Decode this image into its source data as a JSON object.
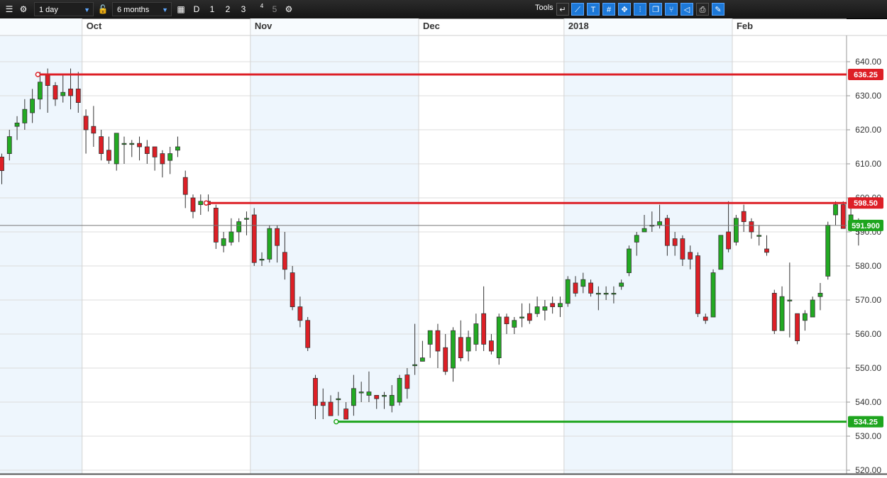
{
  "toolbar": {
    "interval": "1 day",
    "range": "6 months",
    "period_d": "D",
    "period_1": "1",
    "period_2": "2",
    "period_3": "3",
    "period_4": "4",
    "period_5": "5",
    "tools_label": "Tools"
  },
  "icons": [
    "list-icon",
    "gear-icon",
    "lock-icon",
    "calendar-icon",
    "settings-icon",
    "undo-icon",
    "trendline-icon",
    "text-icon",
    "grid-icon",
    "crosshair-icon",
    "candle-icon",
    "duplicate-icon",
    "fork-icon",
    "shape-icon",
    "print-icon",
    "config-icon"
  ],
  "colors": {
    "up": "#22aa22",
    "down": "#dd1f26",
    "accent": "#1c78d8",
    "band": "#eef6fd",
    "price": "#1ea51e"
  },
  "chart_data": {
    "type": "candlestick",
    "x_labels": [
      {
        "label": "Oct",
        "index": 11
      },
      {
        "label": "Nov",
        "index": 33
      },
      {
        "label": "Dec",
        "index": 55
      },
      {
        "label": "2018",
        "index": 74
      },
      {
        "label": "Feb",
        "index": 96
      }
    ],
    "bands": [
      [
        -10,
        11
      ],
      [
        33,
        55
      ],
      [
        74,
        96
      ]
    ],
    "ylim": [
      517,
      647
    ],
    "yticks": [
      520,
      530,
      540,
      550,
      560,
      570,
      580,
      590,
      600,
      610,
      620,
      630,
      640
    ],
    "candles": [
      [
        612,
        608,
        613,
        604
      ],
      [
        613,
        618,
        620,
        611
      ],
      [
        621,
        622,
        624,
        617
      ],
      [
        622,
        626,
        629,
        620
      ],
      [
        625,
        629,
        632,
        622
      ],
      [
        629,
        634,
        637,
        626
      ],
      [
        636,
        633,
        638,
        625
      ],
      [
        633,
        629,
        634,
        627
      ],
      [
        630,
        631,
        636,
        628
      ],
      [
        632,
        630,
        638,
        626
      ],
      [
        632,
        628,
        637,
        625
      ],
      [
        624,
        620,
        626,
        613
      ],
      [
        621,
        619,
        627,
        615
      ],
      [
        618,
        613,
        620,
        611
      ],
      [
        614,
        611,
        618,
        610
      ],
      [
        610,
        619,
        619,
        608
      ],
      [
        616,
        616,
        618,
        610
      ],
      [
        616,
        616,
        617,
        612
      ],
      [
        616,
        615,
        618,
        611
      ],
      [
        615,
        613,
        617,
        610
      ],
      [
        615,
        612,
        615,
        608
      ],
      [
        613,
        610,
        614,
        606
      ],
      [
        611,
        613,
        615,
        607
      ],
      [
        614,
        615,
        618,
        612
      ],
      [
        606,
        601,
        608,
        597
      ],
      [
        600,
        596,
        601,
        594
      ],
      [
        598,
        599,
        601,
        595
      ],
      [
        599,
        598,
        601,
        596
      ],
      [
        597,
        587,
        598,
        585
      ],
      [
        586,
        588,
        590,
        584
      ],
      [
        587,
        590,
        594,
        586
      ],
      [
        590,
        593,
        594,
        587
      ],
      [
        594,
        594,
        596,
        589
      ],
      [
        595,
        581,
        597,
        580
      ],
      [
        582,
        582,
        584,
        580
      ],
      [
        582,
        591,
        592,
        581
      ],
      [
        591,
        586,
        592,
        581
      ],
      [
        584,
        579,
        590,
        576
      ],
      [
        578,
        568,
        580,
        567
      ],
      [
        568,
        564,
        571,
        562
      ],
      [
        564,
        556,
        565,
        555
      ],
      [
        547,
        539,
        548,
        535
      ],
      [
        540,
        539,
        544,
        535
      ],
      [
        540,
        536,
        542,
        537
      ],
      [
        541,
        541,
        543,
        536
      ],
      [
        538,
        535,
        540,
        535
      ],
      [
        539,
        544,
        548,
        536
      ],
      [
        543,
        543,
        546,
        540
      ],
      [
        542,
        543,
        549,
        540
      ],
      [
        542,
        541,
        542,
        538
      ],
      [
        542,
        542,
        543,
        538
      ],
      [
        539,
        542,
        545,
        537
      ],
      [
        540,
        547,
        548,
        539
      ],
      [
        548,
        544,
        550,
        541
      ],
      [
        551,
        551,
        563,
        548
      ],
      [
        552,
        553,
        558,
        552
      ],
      [
        557,
        561,
        559,
        553
      ],
      [
        561,
        555,
        563,
        550
      ],
      [
        556,
        549,
        560,
        548
      ],
      [
        550,
        561,
        562,
        546
      ],
      [
        559,
        553,
        564,
        552
      ],
      [
        555,
        559,
        561,
        552
      ],
      [
        557,
        563,
        566,
        555
      ],
      [
        566,
        557,
        574,
        555
      ],
      [
        558,
        555,
        560,
        554
      ],
      [
        553,
        565,
        566,
        551
      ],
      [
        565,
        563,
        566,
        560
      ],
      [
        562,
        564,
        565,
        560
      ],
      [
        565,
        565,
        569,
        562
      ],
      [
        566,
        564,
        569,
        563
      ],
      [
        566,
        568,
        571,
        565
      ],
      [
        567,
        568,
        570,
        564
      ],
      [
        569,
        568,
        571,
        566
      ],
      [
        568,
        569,
        571,
        565
      ],
      [
        569,
        576,
        577,
        568
      ],
      [
        575,
        572,
        577,
        571
      ],
      [
        574,
        576,
        578,
        572
      ],
      [
        575,
        572,
        576,
        571
      ],
      [
        572,
        572,
        574,
        567
      ],
      [
        572,
        572,
        574,
        570
      ],
      [
        572,
        572,
        574,
        569
      ],
      [
        574,
        575,
        576,
        573
      ],
      [
        578,
        585,
        586,
        577
      ],
      [
        587,
        589,
        590,
        583
      ],
      [
        590,
        591,
        595,
        590
      ],
      [
        592,
        592,
        596,
        590
      ],
      [
        592,
        593,
        598,
        591
      ],
      [
        594,
        586,
        595,
        583
      ],
      [
        588,
        586,
        590,
        583
      ],
      [
        588,
        582,
        589,
        580
      ],
      [
        584,
        582,
        586,
        579
      ],
      [
        583,
        566,
        584,
        565
      ],
      [
        565,
        564,
        566,
        563
      ],
      [
        565,
        578,
        579,
        566
      ],
      [
        579,
        589,
        589,
        582
      ],
      [
        590,
        585,
        599,
        584
      ],
      [
        587,
        594,
        595,
        586
      ],
      [
        596,
        593,
        598,
        590
      ],
      [
        593,
        590,
        594,
        588
      ],
      [
        589,
        589,
        592,
        586
      ],
      [
        585,
        584,
        589,
        583
      ],
      [
        572,
        561,
        573,
        560
      ],
      [
        561,
        571,
        574,
        561
      ],
      [
        570,
        570,
        581,
        559
      ],
      [
        566,
        558,
        566,
        557
      ],
      [
        564,
        566,
        567,
        561
      ],
      [
        565,
        570,
        571,
        565
      ],
      [
        571,
        572,
        575,
        567
      ],
      [
        577,
        592,
        593,
        576
      ],
      [
        595,
        598,
        599,
        592
      ],
      [
        598,
        591,
        599,
        591
      ],
      [
        593,
        595,
        600,
        590
      ],
      [
        593,
        591,
        594,
        586
      ]
    ],
    "hlines": [
      {
        "value": 636.25,
        "label": "636.25",
        "color": "#dd1f26",
        "from": 5
      },
      {
        "value": 598.5,
        "label": "598.50",
        "color": "#dd1f26",
        "from": 27
      },
      {
        "value": 534.25,
        "label": "534.25",
        "color": "#1ea51e",
        "from": 44
      }
    ],
    "current": {
      "value": 591.9,
      "label": "591.900",
      "color": "#1ea51e"
    }
  }
}
